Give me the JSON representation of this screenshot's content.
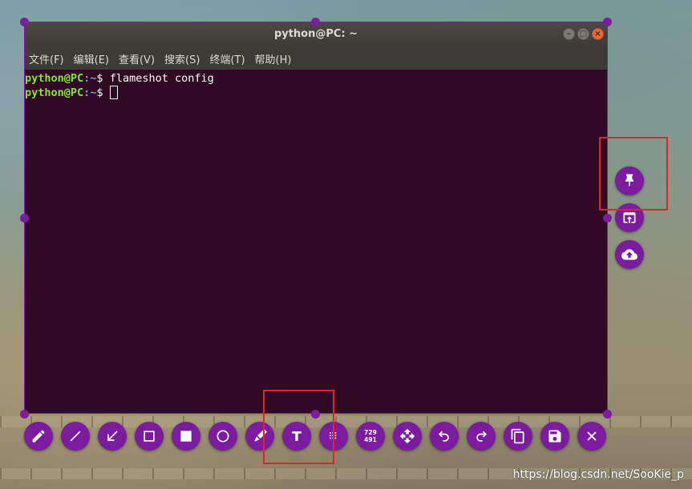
{
  "window": {
    "title": "python@PC: ~",
    "controls": {
      "minimize": "–",
      "maximize": "□",
      "close": "×"
    }
  },
  "menubar": {
    "items": [
      "文件(F)",
      "编辑(E)",
      "查看(V)",
      "搜索(S)",
      "终端(T)",
      "帮助(H)"
    ]
  },
  "terminal": {
    "lines": [
      {
        "user": "python@PC",
        "path": ":~",
        "symbol": "$ ",
        "command": "flameshot config"
      },
      {
        "user": "python@PC",
        "path": ":~",
        "symbol": "$ ",
        "command": ""
      }
    ],
    "colors": {
      "background": "#300a24",
      "user": "#8ae234",
      "path": "#729fcf"
    }
  },
  "flameshot": {
    "accent": "#7b1c9e",
    "size_readout": {
      "width": "729",
      "height": "491"
    },
    "bottom_tools": [
      "pencil-icon",
      "line-icon",
      "arrow-icon",
      "rectangle-icon",
      "filled-rectangle-icon",
      "circle-icon",
      "marker-icon",
      "text-icon",
      "pixelate-icon",
      "size-readout",
      "move-icon",
      "undo-icon",
      "redo-icon",
      "copy-icon",
      "save-icon",
      "exit-icon"
    ],
    "side_tools": [
      "pin-icon",
      "open-with-app-icon",
      "upload-icon"
    ]
  },
  "highlight_color": "#e42323",
  "watermark": "https://blog.csdn.net/SooKie_p"
}
